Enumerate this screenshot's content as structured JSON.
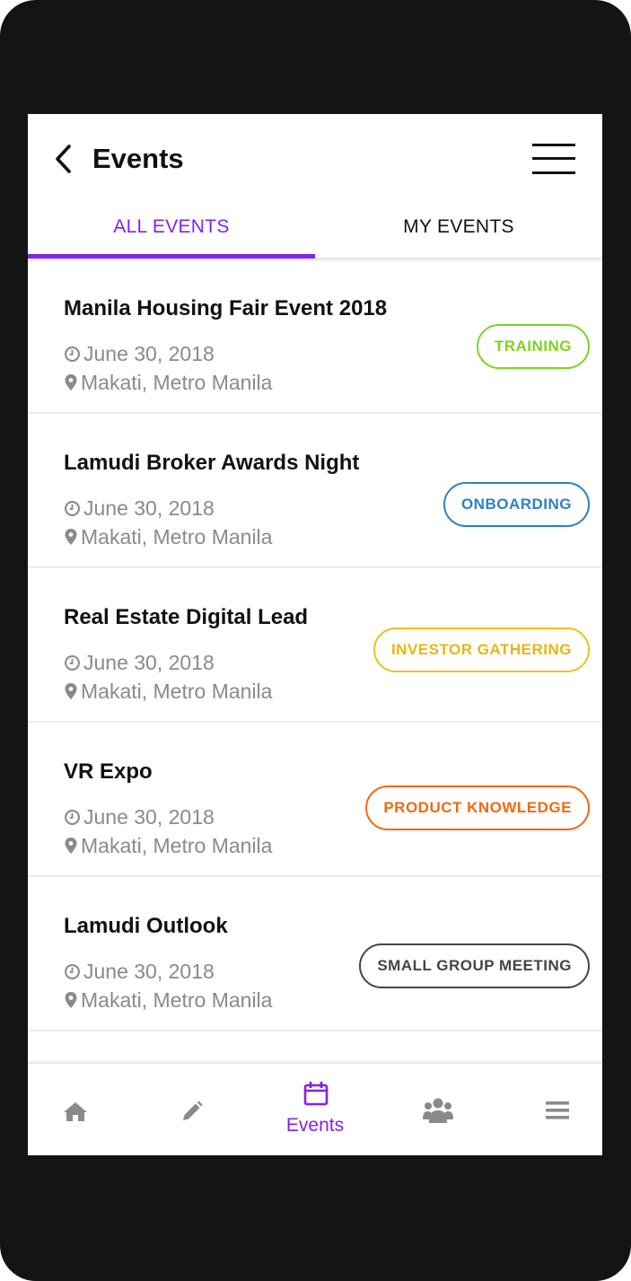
{
  "header": {
    "title": "Events"
  },
  "tabs": [
    {
      "label": "ALL EVENTS",
      "active": true
    },
    {
      "label": "MY EVENTS",
      "active": false
    }
  ],
  "colors": {
    "accent": "#8224e3",
    "training": "#7ed321",
    "onboarding": "#2f80c4",
    "investor": "#f0c020",
    "product": "#ef6a10",
    "small_group": "#444444"
  },
  "events": [
    {
      "title": "Manila Housing Fair Event 2018",
      "date": "June 30, 2018",
      "location": "Makati, Metro Manila",
      "tag": "TRAINING"
    },
    {
      "title": "Lamudi Broker Awards Night",
      "date": "June 30, 2018",
      "location": "Makati, Metro Manila",
      "tag": "ONBOARDING"
    },
    {
      "title": "Real Estate Digital Lead",
      "date": "June 30, 2018",
      "location": "Makati, Metro Manila",
      "tag": "INVESTOR GATHERING"
    },
    {
      "title": "VR Expo",
      "date": "June 30, 2018",
      "location": "Makati, Metro Manila",
      "tag": "PRODUCT KNOWLEDGE"
    },
    {
      "title": "Lamudi Outlook",
      "date": "June 30, 2018",
      "location": "Makati, Metro Manila",
      "tag": "SMALL GROUP MEETING"
    }
  ],
  "bottom_nav": {
    "items": [
      {
        "icon": "home-icon"
      },
      {
        "icon": "pencil-icon"
      },
      {
        "icon": "calendar-icon",
        "label": "Events",
        "active": true
      },
      {
        "icon": "users-icon"
      },
      {
        "icon": "menu-icon"
      }
    ]
  }
}
